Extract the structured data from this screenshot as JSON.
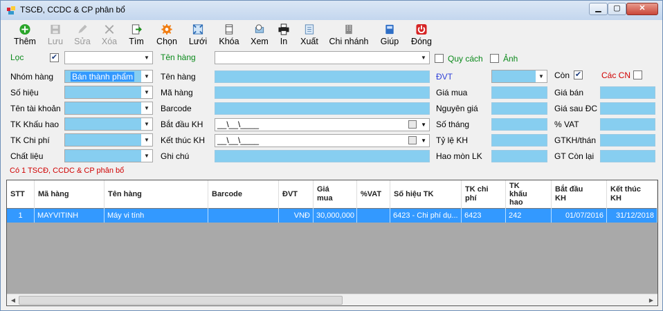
{
  "window": {
    "title": "TSCĐ, CCDC & CP phân bổ"
  },
  "toolbar": {
    "them": "Thêm",
    "luu": "Lưu",
    "sua": "Sửa",
    "xoa": "Xóa",
    "tim": "Tìm",
    "chon": "Chọn",
    "luoi": "Lưới",
    "khoa": "Khóa",
    "xem": "Xem",
    "in": "In",
    "xuat": "Xuất",
    "chi_nhanh": "Chi nhánh",
    "giup": "Giúp",
    "dong": "Đóng"
  },
  "filter": {
    "loc": "Lọc",
    "ten_hang_filter": "Tên hàng",
    "quy_cach": "Quy cách",
    "anh": "Ảnh",
    "loc_checked": true,
    "quy_cach_checked": false,
    "anh_checked": false
  },
  "form": {
    "nhom_hang": "Nhóm hàng",
    "nhom_hang_value": "Bán thành phẩm",
    "so_hieu": "Số hiệu",
    "ten_tai_khoan": "Tên tài khoản",
    "tk_khau_hao": "TK Khấu hao",
    "tk_chi_phi": "TK Chi phí",
    "chat_lieu": "Chất liệu",
    "ten_hang": "Tên hàng",
    "ma_hang": "Mã hàng",
    "barcode": "Barcode",
    "bat_dau_kh": "Bắt đầu KH",
    "ket_thuc_kh": "Kết thúc KH",
    "ghi_chu": "Ghi chú",
    "date_mask": "__\\__\\____",
    "dvt": "ĐVT",
    "gia_mua": "Giá mua",
    "nguyen_gia": "Nguyên giá",
    "so_thang": "Số tháng",
    "ty_le_kh": "Tỷ lệ KH",
    "hao_mon_lk": "Hao mòn LK",
    "con": "Còn",
    "con_checked": true,
    "cac_cn": "Các CN",
    "cac_cn_checked": false,
    "gia_ban": "Giá bán",
    "gia_sau_dc": "Giá sau ĐC",
    "vat": "% VAT",
    "gtkh_thang": "GTKH/thán",
    "gt_con_lai": "GT Còn lại",
    "status": "Có 1 TSCĐ, CCDC & CP phân bổ"
  },
  "grid": {
    "headers": [
      "STT",
      "Mã hàng",
      "Tên hàng",
      "Barcode",
      "ĐVT",
      "Giá\nmua",
      "%VAT",
      "Số hiệu TK",
      "TK chi\nphí",
      "TK\nkhấu\nhao",
      "Bắt đầu\nKH",
      "Kết thúc\nKH"
    ],
    "rows": [
      [
        "1",
        "MAYVITINH",
        "Máy vi tính",
        "",
        "VNĐ",
        "30,000,000",
        "",
        "6423 - Chi phí dụ...",
        "6423",
        "242",
        "01/07/2016",
        "31/12/2018"
      ]
    ]
  },
  "colors": {
    "field_blue": "#87cef0",
    "selection": "#3399ff",
    "label_green": "#0b8a1b",
    "label_red": "#d00000",
    "label_blue": "#2e3fd8"
  }
}
